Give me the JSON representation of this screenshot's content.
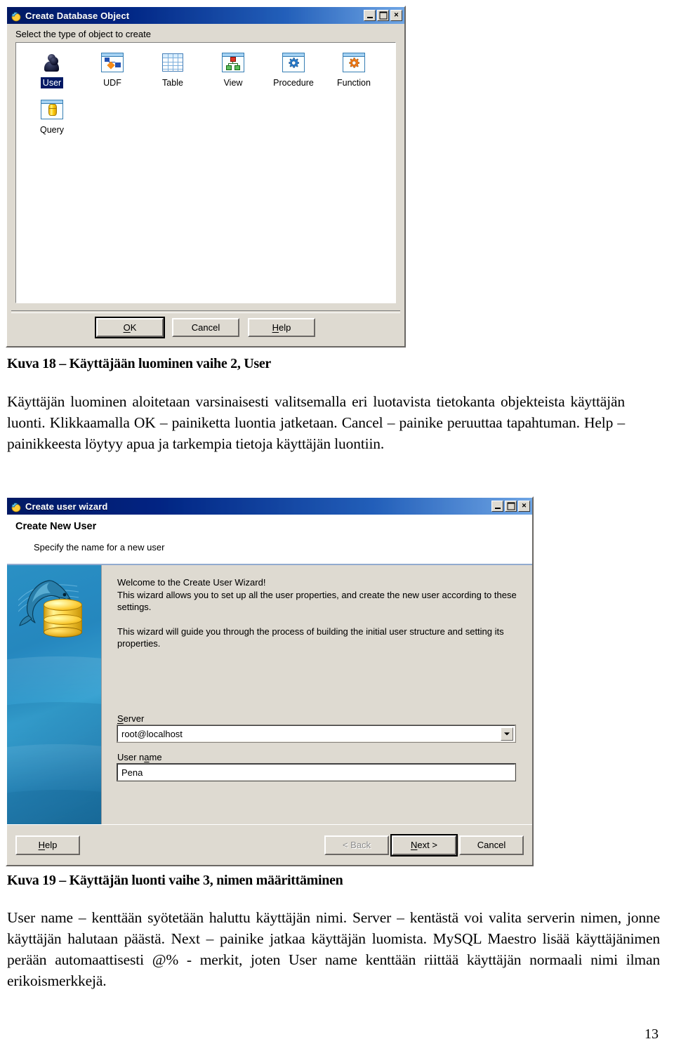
{
  "document": {
    "caption_18": "Kuva 18 – Käyttäjään luominen vaihe 2, User",
    "paragraph_1": "Käyttäjän luominen aloitetaan varsinaisesti valitsemalla eri luotavista tietokanta objekteista käyttäjän luonti. Klikkaamalla OK – painiketta luontia jatketaan. Cancel – painike peruuttaa tapahtuman. Help – painikkeesta löytyy apua ja tarkempia tietoja käyttäjän luontiin.",
    "caption_19": "Kuva 19 – Käyttäjän luonti vaihe 3, nimen määrittäminen",
    "paragraph_2": "User name – kenttään syötetään haluttu käyttäjän nimi. Server – kentästä voi valita serverin nimen, jonne käyttäjän halutaan päästä. Next – painike jatkaa käyttäjän luomista. MySQL Maestro lisää käyttäjänimen perään automaattisesti @% - merkit, joten User name kenttään riittää käyttäjän normaali nimi ilman erikoismerkkejä.",
    "page_number": "13"
  },
  "create_object_dialog": {
    "title": "Create Database Object",
    "prompt": "Select the type of object to create",
    "objects": [
      {
        "label": "User",
        "icon": "user-icon",
        "selected": true
      },
      {
        "label": "UDF",
        "icon": "udf-icon",
        "selected": false
      },
      {
        "label": "Table",
        "icon": "table-icon",
        "selected": false
      },
      {
        "label": "View",
        "icon": "view-icon",
        "selected": false
      },
      {
        "label": "Procedure",
        "icon": "procedure-gear-icon",
        "selected": false
      },
      {
        "label": "Function",
        "icon": "function-gear-icon",
        "selected": false
      },
      {
        "label": "Query",
        "icon": "query-icon",
        "selected": false
      }
    ],
    "buttons": {
      "ok": "OK",
      "ok_accel": "O",
      "cancel": "Cancel",
      "help": "Help",
      "help_accel": "H"
    },
    "window_controls": {
      "minimize": "minimize-button",
      "maximize": "maximize-button",
      "close": "×"
    }
  },
  "user_wizard_dialog": {
    "title": "Create user wizard",
    "header_title": "Create New User",
    "header_subtitle": "Specify the name for a new user",
    "welcome_paragraph_1": "Welcome to the Create User Wizard!\nThis wizard allows you to set up all the user properties, and create the new user according to these settings.",
    "welcome_paragraph_2": "This wizard will guide you through the process of building the initial user structure and setting its properties.",
    "fields": {
      "server_label": "Server",
      "server_accel": "S",
      "server_label_rest": "erver",
      "server_value": "root@localhost",
      "username_label_pre": "User n",
      "username_accel": "a",
      "username_label_post": "me",
      "username_value": "Pena"
    },
    "buttons": {
      "help": "Help",
      "help_accel": "H",
      "back": "< Back",
      "back_pre": "< B",
      "back_post": "ack",
      "next": "Next >",
      "next_accel": "N",
      "next_post": "ext >",
      "cancel": "Cancel"
    },
    "window_controls": {
      "minimize": "minimize-button",
      "maximize": "maximize-button",
      "close": "×"
    }
  },
  "colors": {
    "titlebar_blue": "#0a246a",
    "dialog_face": "#d4d0c8",
    "selection_blue": "#0a246a",
    "sidebar_blue": "#2f8fc0",
    "accent_gold": "#f2c53a"
  }
}
